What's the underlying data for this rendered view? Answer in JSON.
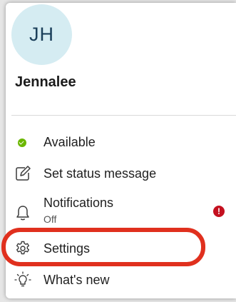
{
  "profile": {
    "initials": "JH",
    "name": "Jennalee"
  },
  "menu": {
    "status": {
      "label": "Available",
      "color": "#6bb700",
      "icon": "check-circle-icon"
    },
    "status_message": {
      "label": "Set status message",
      "icon": "edit-message-icon"
    },
    "notifications": {
      "label": "Notifications",
      "sublabel": "Off",
      "icon": "bell-icon",
      "badge": "!"
    },
    "settings": {
      "label": "Settings",
      "icon": "gear-icon"
    },
    "whats_new": {
      "label": "What's new",
      "icon": "lightbulb-icon"
    }
  },
  "colors": {
    "avatar_bg": "#d5ecf2",
    "alert_badge": "#c4101f",
    "highlight_ring": "#e0301e"
  }
}
